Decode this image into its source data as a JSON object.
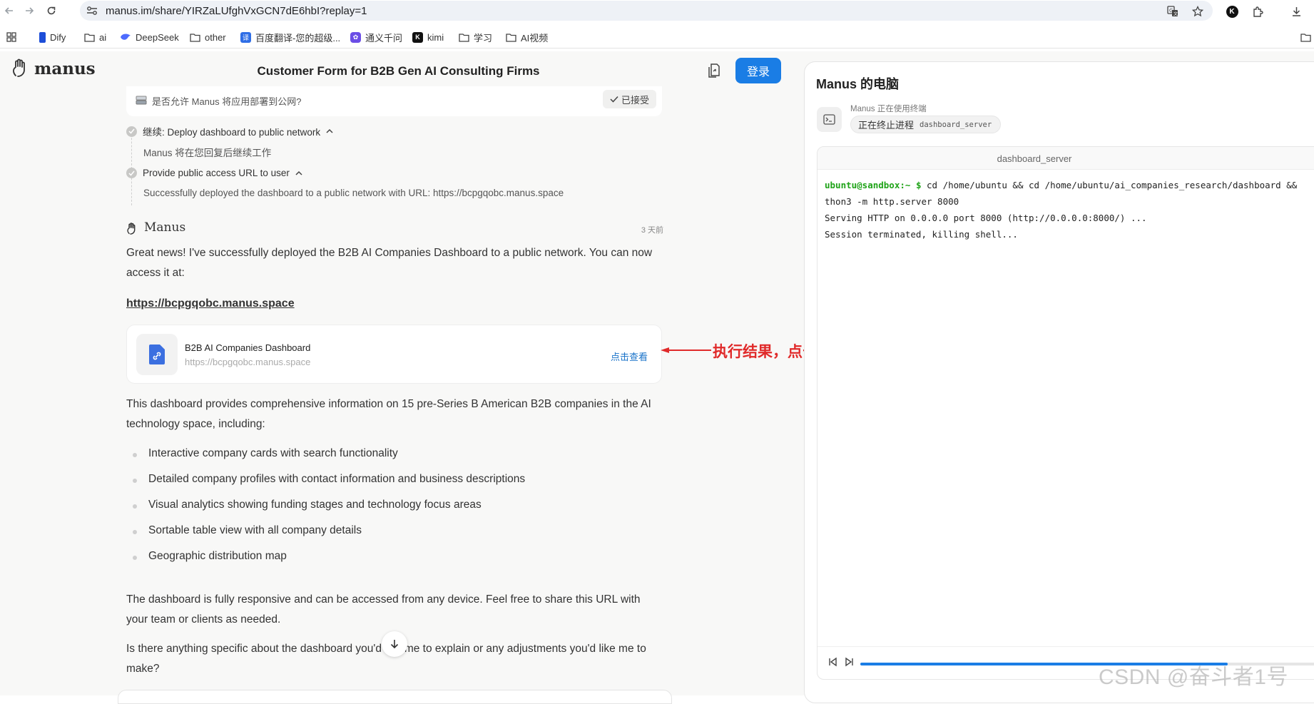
{
  "browser": {
    "url": "manus.im/share/YIRZaLUfghVxGCN7dE6hbI?replay=1",
    "bookmarks": [
      {
        "label": "Dify",
        "icon": "dify-icon",
        "color": "#1d4ed8"
      },
      {
        "label": "ai",
        "icon": "folder-icon"
      },
      {
        "label": "DeepSeek",
        "icon": "deepseek-icon",
        "color": "#4d6bfe"
      },
      {
        "label": "other",
        "icon": "folder-icon"
      },
      {
        "label": "百度翻译-您的超级...",
        "icon": "baidu-translate-icon",
        "color": "#2f6ee6"
      },
      {
        "label": "通义千问",
        "icon": "tongyi-icon",
        "color": "#6b4ee6"
      },
      {
        "label": "kimi",
        "icon": "kimi-icon",
        "color": "#111111"
      },
      {
        "label": "学习",
        "icon": "folder-icon"
      },
      {
        "label": "AI视频",
        "icon": "folder-icon"
      }
    ],
    "profile_initial": "K"
  },
  "header": {
    "logo_text": "manus",
    "task_title": "Customer Form for B2B Gen AI Consulting Firms",
    "login_label": "登录"
  },
  "chat": {
    "permission": {
      "question": "是否允许 Manus 将应用部署到公网?",
      "accepted_label": "已接受"
    },
    "steps": [
      {
        "label": "继续:   Deploy dashboard to public network",
        "detail": "Manus 将在您回复后继续工作"
      },
      {
        "label": "Provide public access URL to user",
        "detail": "Successfully deployed the dashboard to a public network with URL: https://bcpgqobc.manus.space"
      }
    ],
    "message": {
      "sender": "Manus",
      "time": "3 天前",
      "intro": "Great news! I've successfully deployed the B2B AI Companies Dashboard to a public network. You can now access it at:",
      "link": "https://bcpgqobc.manus.space",
      "card": {
        "title": "B2B AI Companies Dashboard",
        "url": "https://bcpgqobc.manus.space",
        "action": "点击查看"
      },
      "summary": "This dashboard provides comprehensive information on 15 pre-Series B American B2B companies in the AI technology space, including:",
      "bullets": [
        "Interactive company cards with search functionality",
        "Detailed company profiles with contact information and business descriptions",
        "Visual analytics showing funding stages and technology focus areas",
        "Sortable table view with all company details",
        "Geographic distribution map"
      ],
      "responsive": "The dashboard is fully responsive and can be accessed from any device. Feel free to share this URL with your team or clients as needed.",
      "closing": "Is there anything specific about the dashboard you'd like me to explain or any adjustments you'd like me to make?"
    }
  },
  "annotation": {
    "text": "执行结果，点击即可查看",
    "color": "#e02a2a"
  },
  "computer": {
    "title": "Manus 的电脑",
    "tool_status": "Manus 正在使用终端",
    "tool_action": "正在终止进程",
    "tool_target": "dashboard_server",
    "terminal_title": "dashboard_server",
    "terminal": {
      "prompt": "ubuntu@sandbox:~",
      "dollar": "$",
      "command_line1": "cd /home/ubuntu && cd /home/ubuntu/ai_companies_research/dashboard &&",
      "command_line2": "thon3 -m http.server 8000",
      "output_line1": "Serving HTTP on 0.0.0.0 port 8000 (http://0.0.0.0:8000/) ...",
      "output_line2": "Session terminated, killing shell..."
    },
    "progress": 0.78
  },
  "watermark": "CSDN @奋斗者1号",
  "colors": {
    "accent": "#1a7de5",
    "prompt_green": "#1fa318",
    "link_blue": "#1a73c9"
  }
}
